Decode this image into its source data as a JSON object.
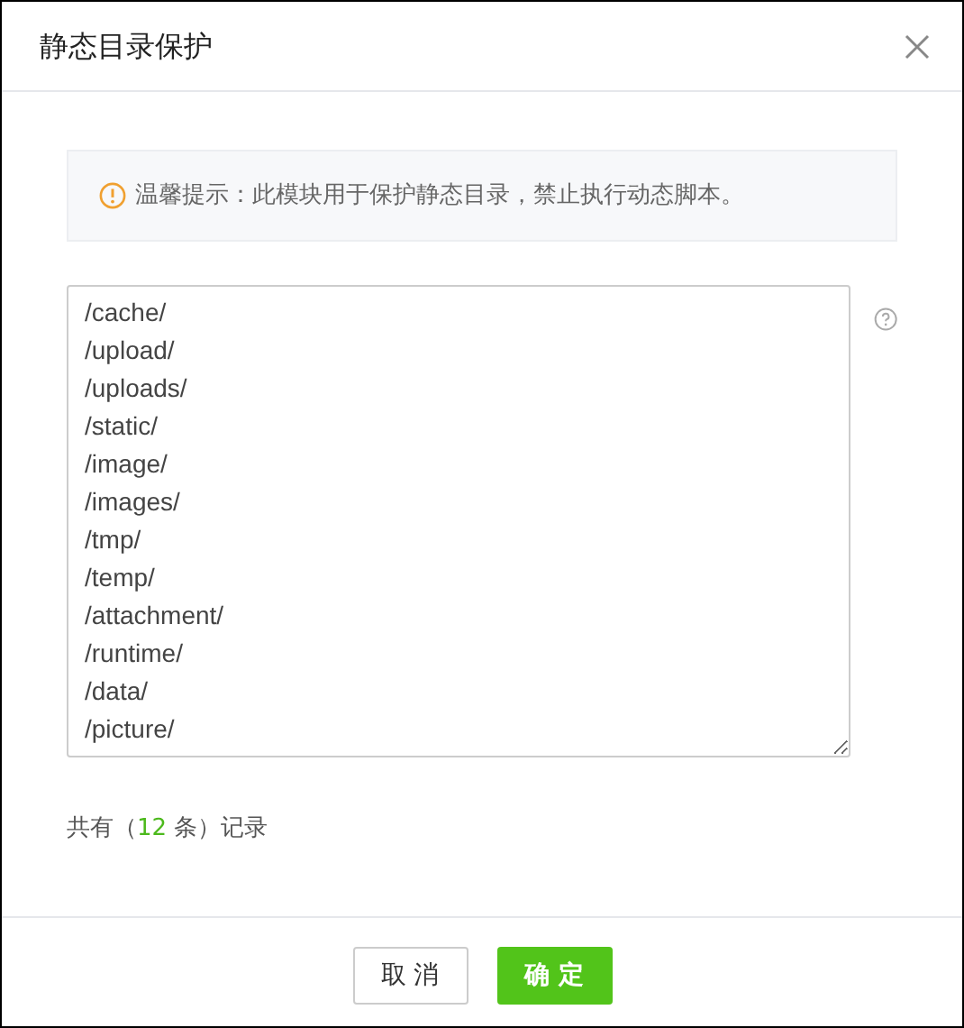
{
  "dialog": {
    "title": "静态目录保护"
  },
  "notice": {
    "text": "温馨提示：此模块用于保护静态目录，禁止执行动态脚本。"
  },
  "directories": {
    "value": "/cache/\n/upload/\n/uploads/\n/static/\n/image/\n/images/\n/tmp/\n/temp/\n/attachment/\n/runtime/\n/data/\n/picture/"
  },
  "record_count": {
    "prefix": "共有（",
    "count": "12",
    "suffix": " 条）记录"
  },
  "buttons": [
    {
      "kind": "secondary",
      "label": "取 消"
    },
    {
      "kind": "primary",
      "label": "确 定"
    }
  ]
}
